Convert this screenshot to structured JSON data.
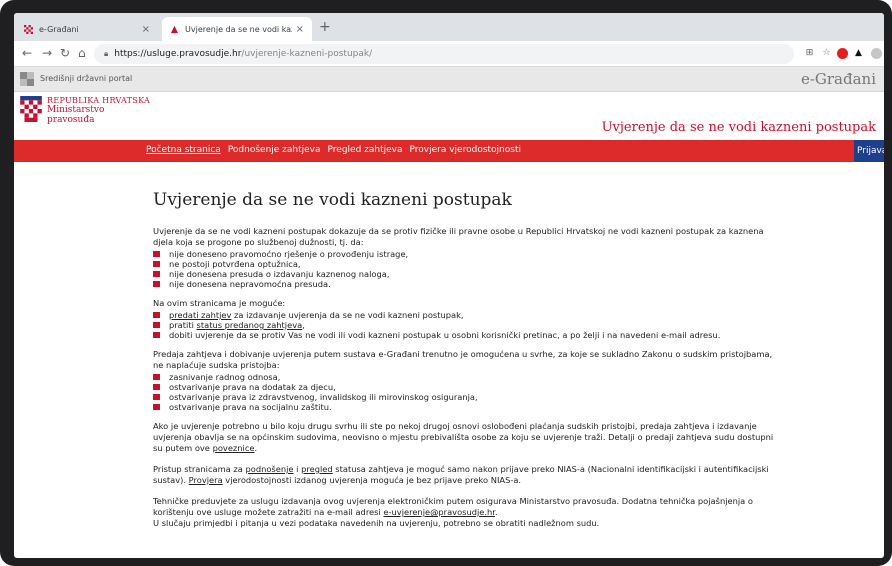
{
  "browser": {
    "tabs": [
      {
        "title": "e-Građani",
        "active": false
      },
      {
        "title": "Uvjerenje da se ne vodi kaznen",
        "active": true
      }
    ],
    "close_glyph": "×",
    "new_tab_glyph": "+",
    "url_host": "https://usluge.pravosudje.hr",
    "url_path": "/uvjerenje-kazneni-postupak/"
  },
  "portal": {
    "name": "Središnji državni portal",
    "brand": "e-Građani"
  },
  "ministry": {
    "line1": "REPUBLIKA HRVATSKA",
    "line2": "Ministarstvo",
    "line3": "pravosuđa"
  },
  "service_title": "Uvjerenje da se ne vodi kazneni postupak",
  "nav": {
    "items": [
      "Početna stranica",
      "Podnošenje zahtjeva",
      "Pregled zahtjeva",
      "Provjera vjerodostojnosti"
    ],
    "login": "Prijava"
  },
  "page": {
    "heading": "Uvjerenje da se ne vodi kazneni postupak",
    "intro": "Uvjerenje da se ne vodi kazneni postupak dokazuje da se protiv fizičke ili pravne osobe u Republici Hrvatskoj ne vodi kazneni postupak za kaznena djela koja se progone po službenoj dužnosti, tj. da:",
    "intro_list": [
      "nije doneseno pravomoćno rješenje o provođenju istrage,",
      "ne postoji potvrđena optužnica,",
      "nije donesena presuda o izdavanju kaznenog naloga,",
      "nije donesena nepravomoćna presuda."
    ],
    "possible_label": "Na ovim stranicama je moguće:",
    "possible_1_link": "predati zahtjev",
    "possible_1_rest": " za izdavanje uvjerenja da se ne vodi kazneni postupak,",
    "possible_2_pre": "pratiti ",
    "possible_2_link": "status predanog zahtjeva",
    "possible_2_rest": ",",
    "possible_3": "dobiti uvjerenje da se protiv Vas ne vodi ili vodi kazneni postupak u osobni korisnički pretinac, a po želji i na navedeni e-mail adresu.",
    "free_text": "Predaja zahtjeva i dobivanje uvjerenja putem sustava e-Građani trenutno je omogućena u svrhe, za koje se sukladno Zakonu o sudskim pristojbama, ne naplaćuje sudska pristojba:",
    "free_list": [
      "zasnivanje radnog odnosa,",
      "ostvarivanje prava na dodatak za djecu,",
      "ostvarivanje prava iz zdravstvenog, invalidskog ili mirovinskog osiguranja,",
      "ostvarivanje prava na socijalnu zaštitu."
    ],
    "other_text": "Ako je uvjerenje potrebno u bilo koju drugu svrhu ili ste po nekoj drugoj osnovi oslobođeni plaćanja sudskih pristojbi, predaja zahtjeva i izdavanje uvjerenja obavlja se na općinskim sudovima, neovisno o mjestu prebivališta osobe za koju se uvjerenje traži. Detalji o predaji zahtjeva sudu dostupni su putem ove ",
    "other_link": "poveznice",
    "other_end": ".",
    "access_pre": "Pristup stranicama za ",
    "access_link1": "podnošenje",
    "access_mid1": " i ",
    "access_link2": "pregled",
    "access_mid2": " statusa zahtjeva je moguć samo nakon prijave preko NIAS-a (Nacionalni identifikacijski i autentifikacijski sustav). ",
    "access_link3": "Provjera",
    "access_end": " vjerodostojnosti izdanog uvjerenja moguća je bez prijave preko NIAS-a.",
    "tech_text": "Tehničke preduvjete za uslugu izdavanja ovog uvjerenja elektroničkim putem osigurava Ministarstvo pravosuđa. Dodatna tehnička pojašnjenja o korištenju ove usluge možete zatražiti na e-mail adresi ",
    "tech_email": "e-uvjerenje@pravosudje.hr",
    "tech_end": ".",
    "remarks": "U slučaju primjedbi i pitanja u vezi podataka navedenih na uvjerenju, potrebno se obratiti nadležnom sudu."
  },
  "colors": {
    "brand_red": "#dd2a2a",
    "text_red": "#c8102e",
    "login_blue": "#1d3f8e"
  }
}
